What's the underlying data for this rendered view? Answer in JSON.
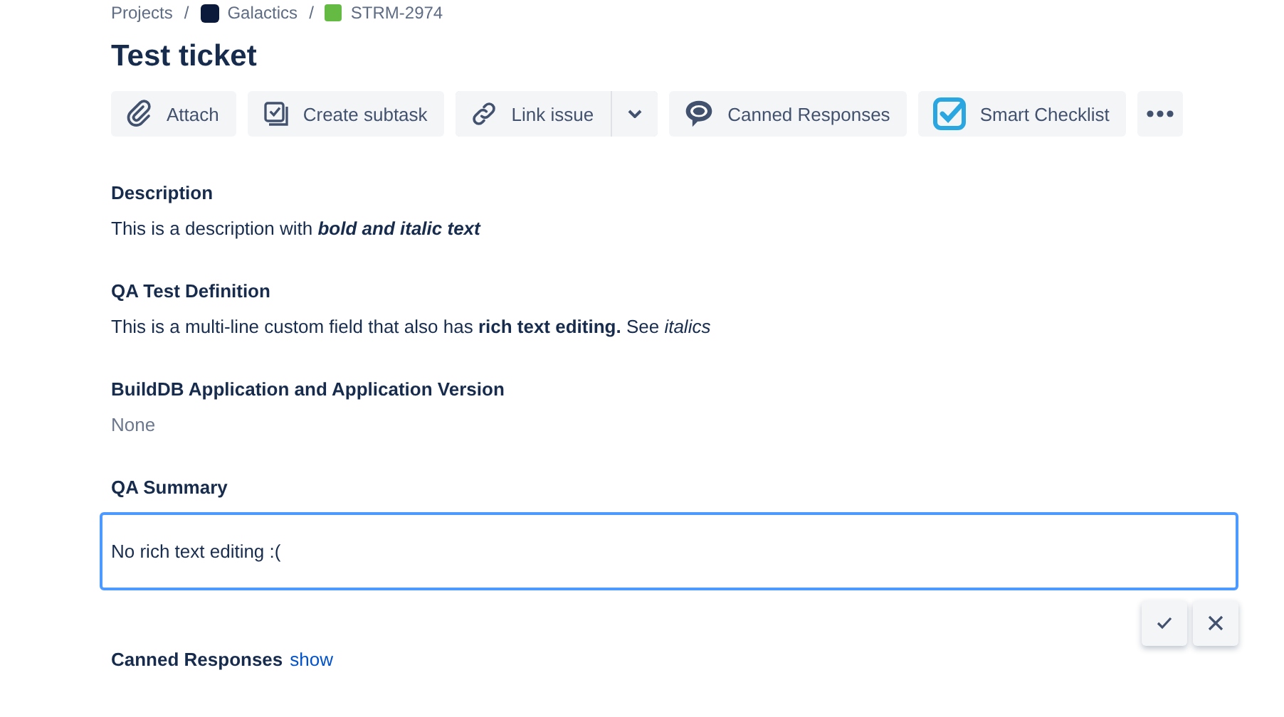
{
  "breadcrumbs": [
    {
      "label": "Projects",
      "kind": "text"
    },
    {
      "label": "Galactics",
      "kind": "project",
      "separator": "/"
    },
    {
      "label": "STRM-2974",
      "kind": "issue",
      "separator": "/"
    }
  ],
  "title": "Test ticket",
  "toolbar": [
    {
      "kind": "attach",
      "label": "Attach"
    },
    {
      "kind": "subtask",
      "label": "Create subtask"
    },
    {
      "kind": "link",
      "label": "Link issue",
      "dropdown": true
    },
    {
      "kind": "canned",
      "label": "Canned Responses"
    },
    {
      "kind": "checklist",
      "label": "Smart Checklist"
    },
    {
      "kind": "more"
    }
  ],
  "fields": [
    {
      "kind": "rich",
      "label": "Description",
      "parts": [
        {
          "text": "This is a description with ",
          "kind": "plain"
        },
        {
          "text": "bold and italic text",
          "kind": "strong"
        }
      ]
    },
    {
      "kind": "rich",
      "label": "QA Test Definition",
      "value": "This is a multi-line custom field that also has **rich text editing.** See *italics*"
    },
    {
      "kind": "empty",
      "label": "BuildDB Application and Application Version",
      "value": "None"
    },
    {
      "kind": "editing",
      "label": "QA Summary",
      "value": "No rich text editing :("
    }
  ],
  "canned_responses": {
    "label": "Canned Responses",
    "link": "show"
  }
}
